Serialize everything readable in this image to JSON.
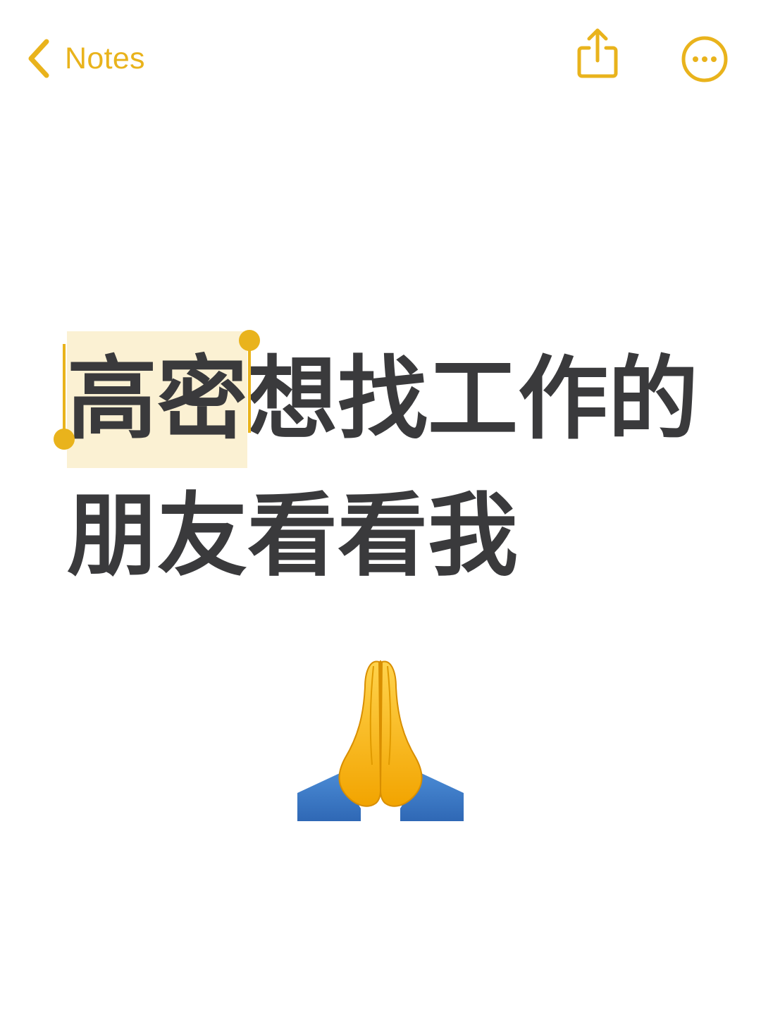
{
  "nav": {
    "back_label": "Notes",
    "back_icon": "chevron-left-icon",
    "share_icon": "share-icon",
    "more_icon": "more-options-icon"
  },
  "note": {
    "selected_text": "高密",
    "line1_rest": "想找工作的",
    "line2": "朋友看看我",
    "emoji_icon": "folded-hands-icon"
  },
  "colors": {
    "accent": "#E9B31C",
    "selection": "#FBF1D3",
    "text": "#3a3a3c",
    "sleeve": "#3C7BC6"
  }
}
